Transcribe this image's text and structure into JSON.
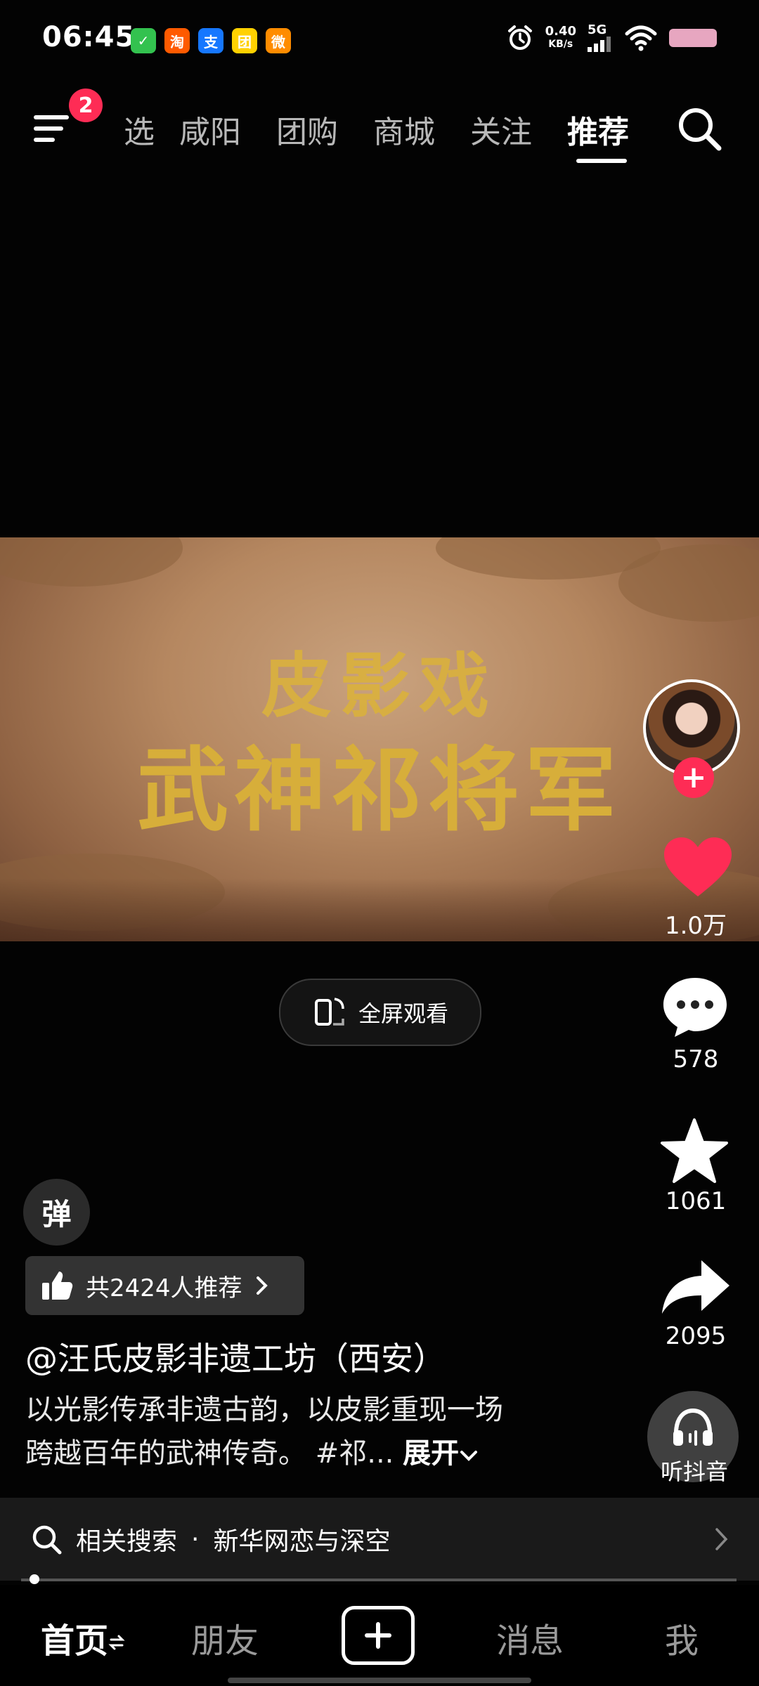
{
  "status_bar": {
    "time": "06:45",
    "net_speed_value": "0.40",
    "net_speed_unit": "KB/s",
    "signal_label": "5G",
    "app_icons": [
      {
        "name": "wechat-task-icon",
        "glyph": "✓",
        "color": "#33c24f"
      },
      {
        "name": "taobao-icon",
        "glyph": "淘",
        "color": "#ff5a00"
      },
      {
        "name": "alipay-icon",
        "glyph": "支",
        "color": "#1677ff"
      },
      {
        "name": "meituan-icon",
        "glyph": "团",
        "color": "#ffd100"
      },
      {
        "name": "weibo-icon",
        "glyph": "微",
        "color": "#ff8c00"
      }
    ]
  },
  "top_nav": {
    "badge_count": "2",
    "tabs": [
      {
        "label": "选"
      },
      {
        "label": "咸阳"
      },
      {
        "label": "团购"
      },
      {
        "label": "商城"
      },
      {
        "label": "关注"
      },
      {
        "label": "推荐"
      }
    ]
  },
  "video": {
    "title_line1": "皮影戏",
    "title_line2": "武神祁将军"
  },
  "fullscreen_label": "全屏观看",
  "actions": {
    "like_count": "1.0万",
    "comment_count": "578",
    "favorite_count": "1061",
    "share_count": "2095",
    "listen_label": "听抖音"
  },
  "danmu_label": "弹",
  "recommend_label": "共2424人推荐",
  "author": "@汪氏皮影非遗工坊（西安）",
  "description_line1": "以光影传承非遗古韵，以皮影重现一场",
  "description_line2": "跨越百年的武神传奇。 #祁...",
  "expand_label": "展开",
  "related_search": {
    "prefix": "相关搜索",
    "dot": "·",
    "query": "新华网恋与深空"
  },
  "bottom_nav": {
    "home": "首页",
    "friends": "朋友",
    "messages": "消息",
    "me": "我"
  },
  "colors": {
    "accent_red": "#fe2c55",
    "video_title_gold": "#d7ae3a"
  }
}
